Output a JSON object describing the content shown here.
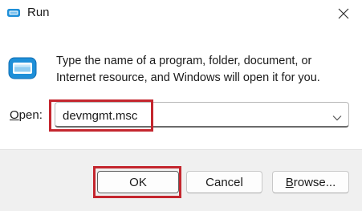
{
  "window": {
    "title": "Run",
    "icons": {
      "app": "run-app-icon",
      "close": "close-icon",
      "dialog": "run-dialog-icon",
      "dropdown": "chevron-down-icon"
    }
  },
  "body": {
    "description": "Type the name of a program, folder, document, or Internet resource, and Windows will open it for you.",
    "open_label_mnemonic": "O",
    "open_label_rest": "pen:",
    "open_value": "devmgmt.msc"
  },
  "buttons": {
    "ok": "OK",
    "cancel": "Cancel",
    "browse_mnemonic": "B",
    "browse_rest": "rowse..."
  },
  "colors": {
    "highlight": "#c4262e",
    "footer_bg": "#f0f0f0",
    "icon_blue": "#1e8fd8"
  }
}
